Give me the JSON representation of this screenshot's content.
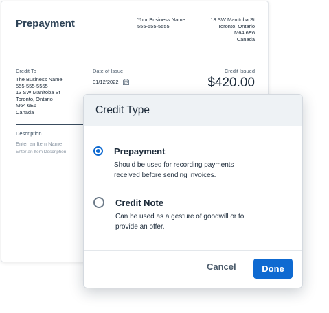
{
  "document": {
    "title": "Prepayment",
    "business": {
      "name": "Your Business Name",
      "phone": "555-555-5555"
    },
    "address": {
      "line1": "13 SW Manitoba St",
      "line2": "Toronto, Ontario",
      "line3": "M64 6E6",
      "line4": "Canada"
    },
    "credit_to": {
      "label": "Credit To",
      "name": "The Business Name",
      "phone": "555-555-5555",
      "street": "13 SW Manitoba St",
      "city": "Toronto, Ontario",
      "postal": "M64 6E6",
      "country": "Canada"
    },
    "date_of_issue": {
      "label": "Date of Issue",
      "value": "01/12/2022",
      "icon": "calendar-icon"
    },
    "credit_issued": {
      "label": "Credit Issued",
      "amount": "$420.00"
    },
    "description": {
      "label": "Description",
      "item_name_placeholder": "Enter an Item Name",
      "item_description_placeholder": "Enter an Item Description"
    }
  },
  "modal": {
    "title": "Credit Type",
    "options": [
      {
        "title": "Prepayment",
        "description_line1": "Should be used for recording payments",
        "description_line2": "received before sending invoices.",
        "selected": true
      },
      {
        "title": "Credit Note",
        "description_line1": "Can be used as a gesture of goodwill or to",
        "description_line2": "provide an offer.",
        "selected": false
      }
    ],
    "cancel_label": "Cancel",
    "done_label": "Done"
  },
  "colors": {
    "accent": "#0f6ad1",
    "title_text": "#2f4458",
    "body_text": "#1d2b3a",
    "header_bg": "#eef2f5"
  }
}
